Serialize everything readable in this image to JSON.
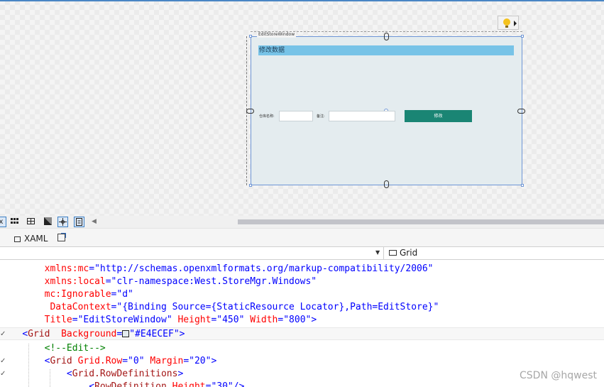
{
  "designer": {
    "window_title": "EditStoreWindow",
    "heading": "修改数据",
    "store_name_label": "仓库名称:",
    "store_name_value": "",
    "remark_label": "备注:",
    "remark_value": "",
    "modify_button": "修改",
    "heading_bar_color": "#77c3e7",
    "window_bg": "#e4ecef",
    "button_color": "#1a8574"
  },
  "view_toolbar": {
    "left_glyph": "x",
    "buttons": [
      "grid-large-icon",
      "grid-small-icon",
      "snap-grid-icon",
      "checkerboard-icon",
      "snap-lines-icon",
      "annotation-icon",
      "scroll-left-icon"
    ]
  },
  "tabs": {
    "xaml_tab": "XAML"
  },
  "nav": {
    "selected_element": "Grid"
  },
  "editor": {
    "lines": [
      {
        "attr": "xmlns:mc",
        "val": "\"http://schemas.openxmlformats.org/markup-compatibility/2006\""
      },
      {
        "attr": "xmlns:local",
        "val": "\"clr-namespace:West.StoreMgr.Windows\""
      },
      {
        "attr": "mc:Ignorable",
        "val": "\"d\""
      },
      {
        "attr": "DataContext",
        "val": "\"{Binding Source={StaticResource Locator},Path=EditStore}\""
      },
      {
        "attr": "Title",
        "val": "\"EditStoreWindow\"",
        "attr2": "Height",
        "val2": "\"450\"",
        "attr3": "Width",
        "val3": "\"800\"",
        "close": ">"
      },
      {
        "open": "<",
        "el": "Grid",
        "attr": "Background",
        "val": "\"#E4ECEF\"",
        "close": ">"
      },
      {
        "comment": "<!--Edit-->"
      },
      {
        "open": "<",
        "el": "Grid",
        "attr": "Grid.Row",
        "val": "\"0\"",
        "attr2": "Margin",
        "val2": "\"20\"",
        "close": ">"
      },
      {
        "open": "<",
        "el": "Grid.RowDefinitions",
        "close": ">"
      },
      {
        "open": "<",
        "el": "RowDefinition",
        "attr": "Height",
        "val": "\"30\"",
        "close": "/>"
      }
    ]
  },
  "watermark": "CSDN @hqwest"
}
